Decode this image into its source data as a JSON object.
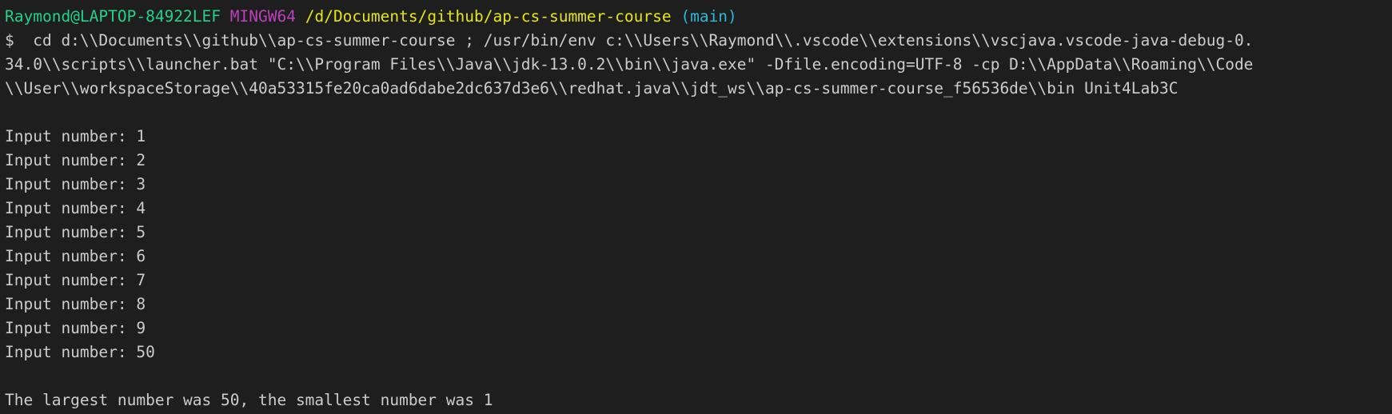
{
  "terminal": {
    "prompt": {
      "user_host": "Raymond@LAPTOP-84922LEF",
      "shell": "MINGW64",
      "path": "/d/Documents/github/ap-cs-summer-course",
      "branch": "(main)"
    },
    "command_lines": [
      "$  cd d:\\\\Documents\\\\github\\\\ap-cs-summer-course ; /usr/bin/env c:\\\\Users\\\\Raymond\\\\.vscode\\\\extensions\\\\vscjava.vscode-java-debug-0.",
      "34.0\\\\scripts\\\\launcher.bat \"C:\\\\Program Files\\\\Java\\\\jdk-13.0.2\\\\bin\\\\java.exe\" -Dfile.encoding=UTF-8 -cp D:\\\\AppData\\\\Roaming\\\\Code",
      "\\\\User\\\\workspaceStorage\\\\40a53315fe20ca0ad6dabe2dc637d3e6\\\\redhat.java\\\\jdt_ws\\\\ap-cs-summer-course_f56536de\\\\bin Unit4Lab3C"
    ],
    "input_lines": [
      "Input number: 1",
      "Input number: 2",
      "Input number: 3",
      "Input number: 4",
      "Input number: 5",
      "Input number: 6",
      "Input number: 7",
      "Input number: 8",
      "Input number: 9",
      "Input number: 50"
    ],
    "result_line": "The largest number was 50, the smallest number was 1"
  },
  "colors": {
    "background": "#1e1e1e",
    "text": "#cccccc",
    "user_host": "#23d18b",
    "shell": "#bc3fbc",
    "path": "#e5e510",
    "branch": "#29b8db"
  }
}
